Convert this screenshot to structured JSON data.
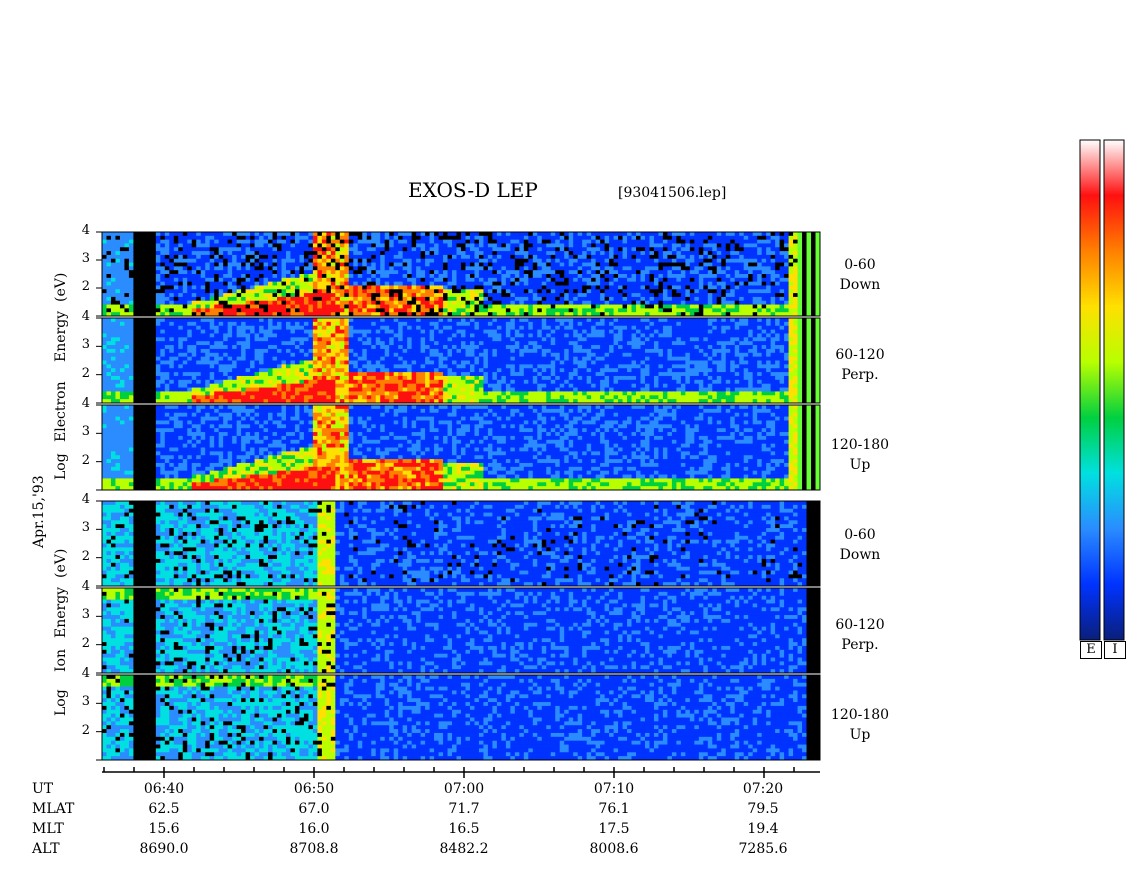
{
  "header": {
    "title": "EXOS-D LEP",
    "filename": "[93041506.lep]"
  },
  "left_labels": {
    "electron": [
      "Log",
      "Electron",
      "Energy",
      "(eV)"
    ],
    "ion": [
      "Log",
      "Ion",
      "Energy",
      "(eV)"
    ],
    "date": "Apr.15,'93"
  },
  "channels": [
    {
      "range": "0-60",
      "dir": "Down"
    },
    {
      "range": "60-120",
      "dir": "Perp."
    },
    {
      "range": "120-180",
      "dir": "Up"
    }
  ],
  "colorbar": {
    "labels": [
      "E",
      "I"
    ]
  },
  "chart_data": {
    "type": "heatmap",
    "title": "EXOS-D LEP",
    "y_ticks": [
      "4",
      "3",
      "2"
    ],
    "ylim": [
      1,
      4
    ],
    "x_ticks": [
      "06:40",
      "06:50",
      "07:00",
      "07:10",
      "07:20"
    ],
    "ephemeris": {
      "rows": [
        {
          "label": "UT",
          "values": [
            "06:40",
            "06:50",
            "07:00",
            "07:10",
            "07:20"
          ]
        },
        {
          "label": "MLAT",
          "values": [
            "62.5",
            "67.0",
            "71.7",
            "76.1",
            "79.5"
          ]
        },
        {
          "label": "MLT",
          "values": [
            "15.6",
            "16.0",
            "16.5",
            "17.5",
            "19.4"
          ]
        },
        {
          "label": "ALT",
          "values": [
            "8690.0",
            "8708.8",
            "8482.2",
            "8008.6",
            "7285.6"
          ]
        }
      ]
    },
    "colors": [
      "#0a1f7a",
      "#0033ff",
      "#2a8cff",
      "#00e0e0",
      "#00d040",
      "#b8ff00",
      "#ffe000",
      "#ff8000",
      "#ff1010",
      "#ffffff"
    ]
  }
}
